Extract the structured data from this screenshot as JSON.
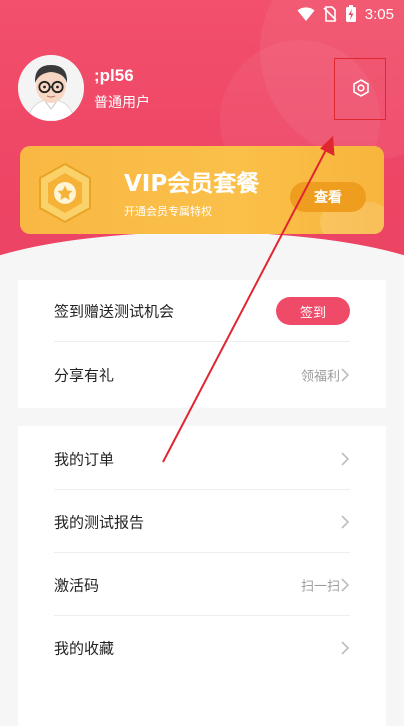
{
  "status": {
    "time": "3:05"
  },
  "profile": {
    "username": ";pl56",
    "user_type": "普通用户"
  },
  "vip": {
    "title": "VIP会员套餐",
    "subtitle": "开通会员专属特权",
    "button": "查看"
  },
  "menu_group1": [
    {
      "label": "签到赠送测试机会",
      "action": "签到"
    },
    {
      "label": "分享有礼",
      "hint": "领福利"
    }
  ],
  "menu_group2": [
    {
      "label": "我的订单",
      "hint": ""
    },
    {
      "label": "我的测试报告",
      "hint": ""
    },
    {
      "label": "激活码",
      "hint": "扫一扫"
    },
    {
      "label": "我的收藏",
      "hint": ""
    }
  ],
  "icons": {
    "status": [
      "wifi-icon",
      "sim-off-icon",
      "battery-charging-icon"
    ],
    "settings": "settings-hex-icon",
    "chevron": "chevron-right-icon",
    "vip_badge": "star-medal-icon"
  },
  "colors": {
    "header": "#ee4565",
    "vip_gold": "#fac049",
    "vip_button": "#ee9d1e",
    "accent": "#ef4a68",
    "annotation": "#e0262e"
  }
}
